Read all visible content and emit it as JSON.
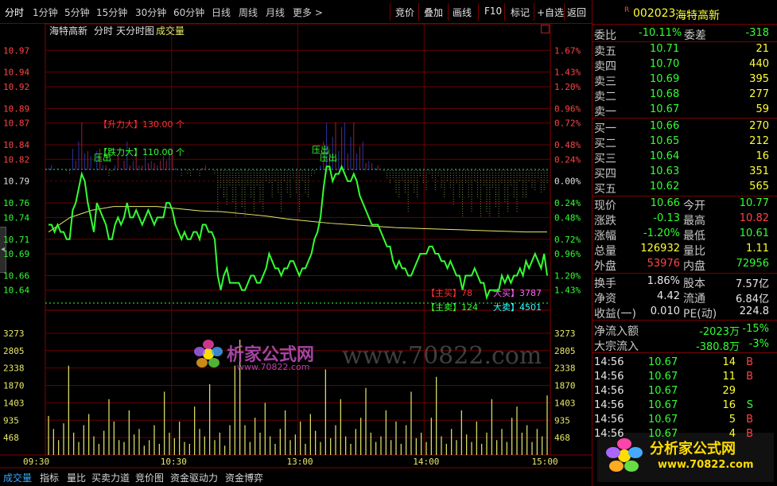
{
  "toolbar": {
    "periods": [
      "分时",
      "1分钟",
      "5分钟",
      "15分钟",
      "30分钟",
      "60分钟",
      "日线",
      "周线",
      "月线",
      "更多 >"
    ],
    "active_period": "分时",
    "buttons": [
      "竞价",
      "叠加",
      "画线",
      "F10",
      "标记",
      "+自选",
      "返回"
    ]
  },
  "chart_header": {
    "stock": "海特高新",
    "mode": "分时",
    "title": "天分时图",
    "volume_label": "成交量"
  },
  "chart_data": [
    {
      "type": "line",
      "title": "海特高新 分时 天分时图",
      "series": [
        {
          "name": "",
          "color": "#33ff33",
          "values": [
            10.73,
            10.73,
            10.72,
            10.73,
            10.72,
            10.72,
            10.71,
            10.71,
            10.75,
            10.76,
            10.78,
            10.8,
            10.79,
            10.76,
            10.74,
            10.72,
            10.76,
            10.75,
            10.74,
            10.73,
            10.71,
            10.71,
            10.73,
            10.74,
            10.73,
            10.74,
            10.76,
            10.74,
            10.74,
            10.75,
            10.74,
            10.73,
            10.74,
            10.75,
            10.74,
            10.73,
            10.74,
            10.74,
            10.74,
            10.76,
            10.76,
            10.75,
            10.73,
            10.72,
            10.71,
            10.72,
            10.71,
            10.71,
            10.72,
            10.72,
            10.71,
            10.73,
            10.73,
            10.72,
            10.72,
            10.71,
            10.66,
            10.64,
            10.66,
            10.67,
            10.65,
            10.65,
            10.65,
            10.65,
            10.64,
            10.64,
            10.65,
            10.66,
            10.66,
            10.65,
            10.65,
            10.66,
            10.67,
            10.69,
            10.68,
            10.67,
            10.67,
            10.66,
            10.67,
            10.67,
            10.68,
            10.68,
            10.67,
            10.66,
            10.67,
            10.67,
            10.68,
            10.69,
            10.71,
            10.72,
            10.74,
            10.78,
            10.81,
            10.81,
            10.79,
            10.8,
            10.8,
            10.81,
            10.8,
            10.79,
            10.79,
            10.8,
            10.79,
            10.77,
            10.76,
            10.75,
            10.74,
            10.73,
            10.73,
            10.73,
            10.72,
            10.71,
            10.7,
            10.7,
            10.68,
            10.67,
            10.68,
            10.67,
            10.67,
            10.66,
            10.66,
            10.67,
            10.68,
            10.69,
            10.69,
            10.69,
            10.7,
            10.7,
            10.69,
            10.69,
            10.68,
            10.68,
            10.67,
            10.68,
            10.67,
            10.66,
            10.66,
            10.64,
            10.66,
            10.66,
            10.66,
            10.67,
            10.66,
            10.65,
            10.65,
            10.63,
            10.64,
            10.64,
            10.64,
            10.64,
            10.66,
            10.65,
            10.66,
            10.65,
            10.66,
            10.66,
            10.67,
            10.66,
            10.68,
            10.67,
            10.68,
            10.69,
            10.68,
            10.67,
            10.69,
            10.66
          ]
        },
        {
          "name": "",
          "color": "#e8e86a",
          "values": [
            10.72,
            10.74,
            10.75,
            10.755,
            10.755,
            10.755,
            10.752,
            10.749,
            10.748,
            10.745,
            10.742,
            10.738,
            10.735,
            10.732,
            10.73,
            10.728,
            10.726,
            10.725,
            10.724,
            10.723,
            10.722,
            10.721,
            10.72,
            10.72
          ]
        }
      ],
      "yticks_price": [
        10.97,
        10.94,
        10.92,
        10.89,
        10.87,
        10.84,
        10.82,
        10.79,
        10.76,
        10.74,
        10.71,
        10.69,
        10.66,
        10.64
      ],
      "yticks_pct": [
        "1.67%",
        "1.43%",
        "1.20%",
        "0.96%",
        "0.72%",
        "0.48%",
        "0.24%",
        "0.00%",
        "0.24%",
        "0.48%",
        "0.72%",
        "0.96%",
        "1.20%",
        "1.43%"
      ],
      "annotations": [
        {
          "text": "【升力大】130.00 个",
          "color": "#ff3333"
        },
        {
          "text": "【跌力大】110.00 个",
          "color": "#33ff33"
        },
        {
          "text": "压出",
          "color": "#33ff33"
        },
        {
          "text": "压出",
          "color": "#33ff33"
        },
        {
          "text": "压出",
          "color": "#33ff33"
        },
        {
          "text": "【主买】78",
          "color": "#ff3333"
        },
        {
          "text": "大买】3787",
          "color": "#ff66ff"
        },
        {
          "text": "【主卖】124",
          "color": "#33ff33"
        },
        {
          "text": "大卖】4501",
          "color": "#33ffff"
        }
      ],
      "ylim": [
        10.62,
        10.99
      ]
    },
    {
      "type": "bar",
      "title": "成交量",
      "yticks": [
        3273,
        2805,
        2338,
        1870,
        1403,
        935,
        468
      ],
      "ylim": [
        0,
        3740
      ],
      "xticks": [
        "09:30",
        "10:30",
        "13:00",
        "14:00",
        "15:00"
      ],
      "color": "#e8e86a",
      "values": [
        1050,
        700,
        400,
        850,
        2400,
        600,
        350,
        800,
        1100,
        500,
        300,
        650,
        1500,
        900,
        400,
        350,
        1200,
        550,
        700,
        250,
        400,
        800,
        300,
        1700,
        600,
        450,
        900,
        350,
        300,
        1300,
        700,
        500,
        1900,
        400,
        600,
        250,
        800,
        2400,
        3100,
        800,
        350,
        1000,
        600,
        1400,
        500,
        300,
        700,
        1200,
        400,
        550,
        900,
        300,
        1100,
        650,
        350,
        2300,
        450,
        800,
        1500,
        500,
        300,
        700,
        1000,
        1800,
        600,
        350,
        500,
        1200,
        400,
        900,
        300,
        800,
        1700,
        450,
        600,
        350,
        1000,
        2100,
        500,
        300,
        700,
        400,
        1200,
        550,
        350,
        900,
        300,
        600,
        1500,
        400,
        700,
        350,
        1000,
        1300,
        600,
        800,
        350,
        700,
        500,
        1600
      ]
    }
  ],
  "watermark": {
    "site": "分析家公式网",
    "domain": "www.70822.com",
    "url_text": "www.70822.com",
    "prefix": "析家公式网"
  },
  "quote": {
    "flag": "R",
    "code": "002023",
    "name": "海特高新",
    "wei_bi_label": "委比",
    "wei_bi": "-10.11%",
    "wei_cha_label": "委差",
    "wei_cha": "-318",
    "asks": [
      {
        "label": "卖五",
        "price": "10.71",
        "vol": "21"
      },
      {
        "label": "卖四",
        "price": "10.70",
        "vol": "440"
      },
      {
        "label": "卖三",
        "price": "10.69",
        "vol": "395"
      },
      {
        "label": "卖二",
        "price": "10.68",
        "vol": "277"
      },
      {
        "label": "卖一",
        "price": "10.67",
        "vol": "59"
      }
    ],
    "bids": [
      {
        "label": "买一",
        "price": "10.66",
        "vol": "270"
      },
      {
        "label": "买二",
        "price": "10.65",
        "vol": "212"
      },
      {
        "label": "买三",
        "price": "10.64",
        "vol": "16"
      },
      {
        "label": "买四",
        "price": "10.63",
        "vol": "351"
      },
      {
        "label": "买五",
        "price": "10.62",
        "vol": "565"
      }
    ],
    "stats": [
      {
        "l1": "现价",
        "v1": "10.66",
        "c1": "#33ff33",
        "l2": "今开",
        "v2": "10.77",
        "c2": "#33ff33"
      },
      {
        "l1": "涨跌",
        "v1": "-0.13",
        "c1": "#33ff33",
        "l2": "最高",
        "v2": "10.82",
        "c2": "#ff4444"
      },
      {
        "l1": "涨幅",
        "v1": "-1.20%",
        "c1": "#33ff33",
        "l2": "最低",
        "v2": "10.61",
        "c2": "#33ff33"
      },
      {
        "l1": "总量",
        "v1": "126932",
        "c1": "#ffff33",
        "l2": "量比",
        "v2": "1.11",
        "c2": "#ffff33"
      },
      {
        "l1": "外盘",
        "v1": "53976",
        "c1": "#ff4444",
        "l2": "内盘",
        "v2": "72956",
        "c2": "#33ff33"
      }
    ],
    "stats2": [
      {
        "l1": "换手",
        "v1": "1.86%",
        "l2": "股本",
        "v2": "7.57亿"
      },
      {
        "l1": "净资",
        "v1": "4.42",
        "l2": "流通",
        "v2": "6.84亿"
      },
      {
        "l1": "收益(一)",
        "v1": "0.010",
        "l2": "PE(动)",
        "v2": "224.8"
      }
    ],
    "flows": [
      {
        "label": "净流入额",
        "value": "-2023万",
        "pct": "-15%"
      },
      {
        "label": "大宗流入",
        "value": "-380.8万",
        "pct": "-3%"
      }
    ],
    "ticks": [
      {
        "time": "14:56",
        "price": "10.67",
        "vol": "14",
        "side": "B"
      },
      {
        "time": "14:56",
        "price": "10.67",
        "vol": "11",
        "side": "B"
      },
      {
        "time": "14:56",
        "price": "10.67",
        "vol": "29",
        "side": ""
      },
      {
        "time": "14:56",
        "price": "10.67",
        "vol": "16",
        "side": "S"
      },
      {
        "time": "14:56",
        "price": "10.67",
        "vol": "5",
        "side": "B"
      },
      {
        "time": "14:56",
        "price": "10.67",
        "vol": "4",
        "side": "B"
      }
    ]
  },
  "bottom_tabs": [
    "成交量",
    "指标",
    "量比",
    "买卖力道",
    "竞价图",
    "资金驱动力",
    "资金博弈"
  ]
}
